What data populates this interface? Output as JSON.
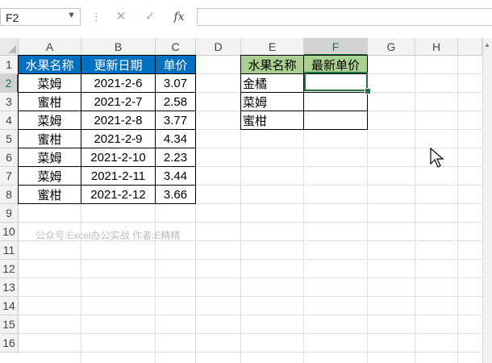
{
  "formula_bar": {
    "name_box": "F2",
    "cancel_icon": "✕",
    "enter_icon": "✓",
    "function_label": "fx",
    "formula": ""
  },
  "columns": [
    "A",
    "B",
    "C",
    "D",
    "E",
    "F",
    "G",
    "H"
  ],
  "rows": [
    "1",
    "2",
    "3",
    "4",
    "5",
    "6",
    "7",
    "8",
    "9",
    "10",
    "11",
    "12",
    "13",
    "14",
    "15",
    "16"
  ],
  "selected_cell": "F2",
  "fruit_table": {
    "headers": [
      "水果名称",
      "更新日期",
      "单价"
    ],
    "rows": [
      [
        "菜姆",
        "2021-2-6",
        "3.07"
      ],
      [
        "蜜柑",
        "2021-2-7",
        "2.58"
      ],
      [
        "菜姆",
        "2021-2-8",
        "3.77"
      ],
      [
        "蜜柑",
        "2021-2-9",
        "4.34"
      ],
      [
        "菜姆",
        "2021-2-10",
        "2.23"
      ],
      [
        "菜姆",
        "2021-2-11",
        "3.44"
      ],
      [
        "蜜柑",
        "2021-2-12",
        "3.66"
      ]
    ],
    "header_color": "#0070c0"
  },
  "lookup_table": {
    "headers": [
      "水果名称",
      "最新单价"
    ],
    "rows": [
      [
        "金橘",
        ""
      ],
      [
        "菜姆",
        ""
      ],
      [
        "蜜柑",
        ""
      ]
    ],
    "header_color": "#a9d08e"
  },
  "watermark": "公众号:Excel办公实战  作者:E精精",
  "accent_color": "#217346"
}
